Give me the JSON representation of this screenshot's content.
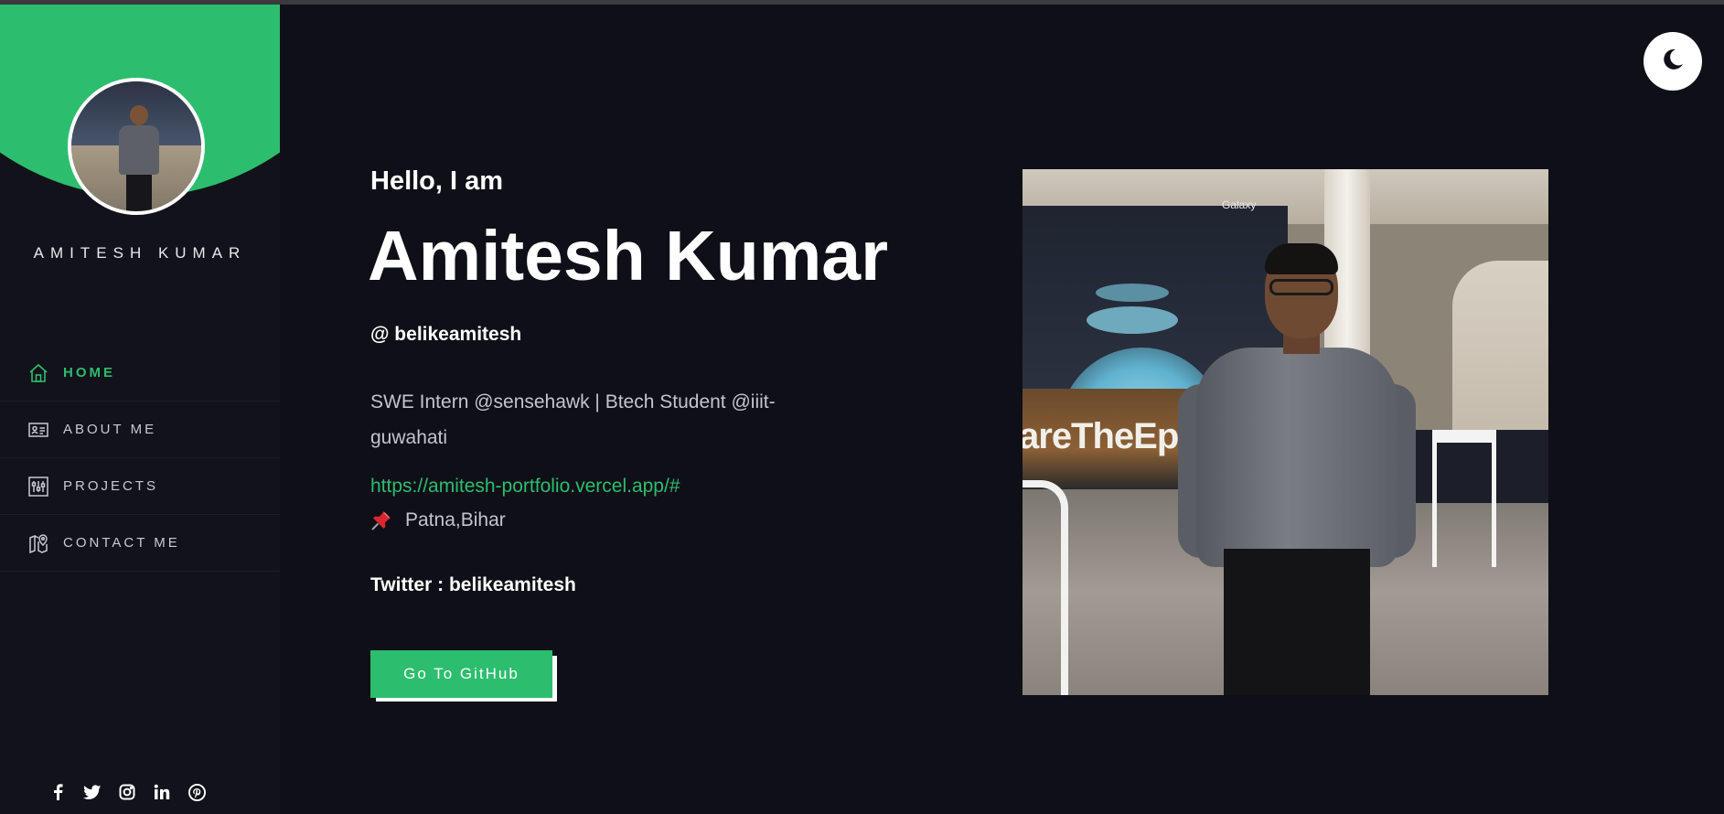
{
  "sidebar": {
    "name": "AMITESH KUMAR",
    "nav": [
      {
        "label": "HOME",
        "icon": "home-icon",
        "active": true
      },
      {
        "label": "ABOUT ME",
        "icon": "id-card-icon",
        "active": false
      },
      {
        "label": "PROJECTS",
        "icon": "sliders-icon",
        "active": false
      },
      {
        "label": "CONTACT ME",
        "icon": "map-pin-icon",
        "active": false
      }
    ],
    "socials": [
      "facebook-icon",
      "twitter-icon",
      "instagram-icon",
      "linkedin-icon",
      "pinterest-icon"
    ]
  },
  "theme_toggle": {
    "icon": "moon-icon"
  },
  "hero": {
    "greeting": "Hello, I am",
    "name": "Amitesh Kumar",
    "handle": "@ belikeamitesh",
    "bio": "SWE Intern @sensehawk | Btech Student @iiit-guwahati",
    "website": "https://amitesh-portfolio.vercel.app/#",
    "location": "Patna,Bihar",
    "twitter": "Twitter : belikeamitesh",
    "button_label": "Go To GitHub"
  },
  "portrait": {
    "brand_text": "Galaxy",
    "stage_text": "areTheEp"
  },
  "colors": {
    "accent": "#2dbd6e",
    "background": "#0f0f17",
    "sidebar": "#11121a"
  }
}
